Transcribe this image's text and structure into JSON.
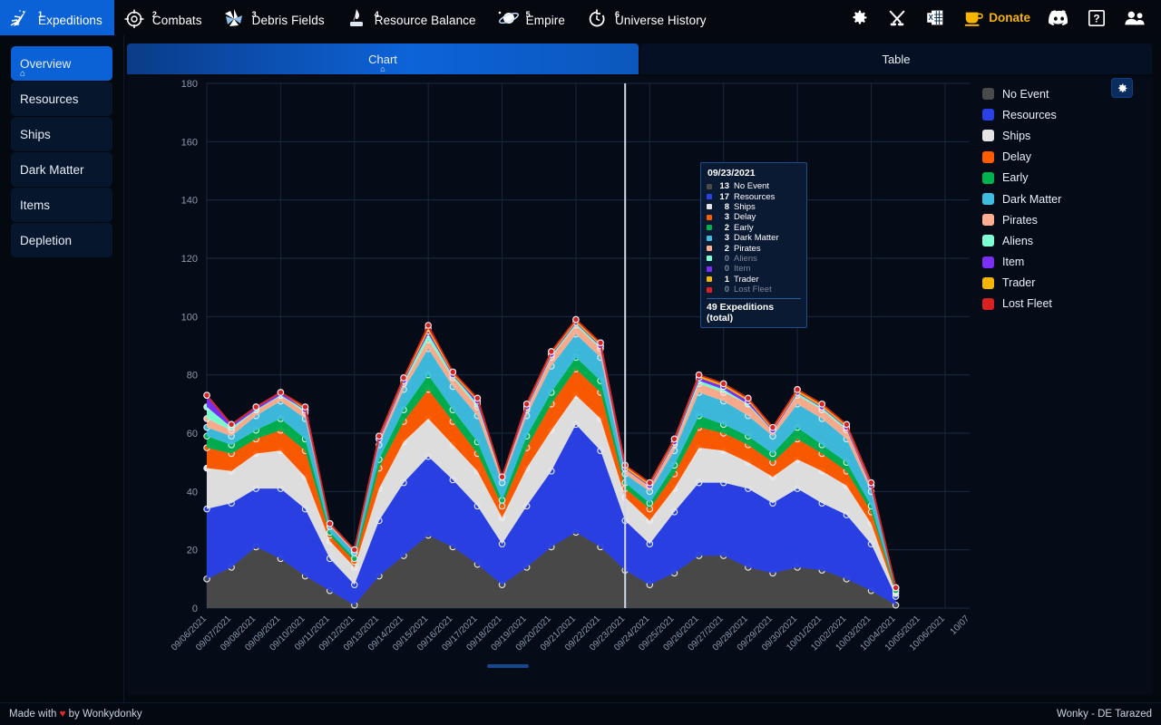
{
  "topnav": {
    "items": [
      {
        "num": "1",
        "label": "Expeditions",
        "icon": "comet-icon",
        "active": true,
        "home": true
      },
      {
        "num": "2",
        "label": "Combats",
        "icon": "crosshair-icon",
        "active": false
      },
      {
        "num": "3",
        "label": "Debris Fields",
        "icon": "debris-icon",
        "active": false
      },
      {
        "num": "4",
        "label": "Resource Balance",
        "icon": "resource-balance-icon",
        "active": false
      },
      {
        "num": "5",
        "label": "Empire",
        "icon": "planet-icon",
        "active": false
      },
      {
        "num": "6",
        "label": "Universe History",
        "icon": "clock-icon",
        "active": false
      }
    ],
    "tools": [
      {
        "name": "settings-icon",
        "glyph": "gear"
      },
      {
        "name": "tools-icon",
        "glyph": "tools"
      },
      {
        "name": "excel-export-icon",
        "glyph": "excel"
      }
    ],
    "donate": {
      "label": "Donate",
      "icon": "coffee-icon",
      "color": "#f7b500"
    },
    "right_icons": [
      {
        "name": "discord-icon"
      },
      {
        "name": "help-icon",
        "glyph": "?"
      },
      {
        "name": "users-icon"
      }
    ]
  },
  "sidebar": {
    "items": [
      {
        "label": "Overview",
        "active": true,
        "home": true
      },
      {
        "label": "Resources",
        "active": false
      },
      {
        "label": "Ships",
        "active": false
      },
      {
        "label": "Dark Matter",
        "active": false
      },
      {
        "label": "Items",
        "active": false
      },
      {
        "label": "Depletion",
        "active": false
      }
    ]
  },
  "tabs": [
    {
      "label": "Chart",
      "active": true,
      "home": true
    },
    {
      "label": "Table",
      "active": false
    }
  ],
  "tooltip": {
    "date": "09/23/2021",
    "rows": [
      {
        "value": "13",
        "label": "No Event",
        "color": "#4a4a4a",
        "zero": false
      },
      {
        "value": "17",
        "label": "Resources",
        "color": "#2a41e8",
        "zero": false
      },
      {
        "value": "8",
        "label": "Ships",
        "color": "#e4e4e4",
        "zero": false
      },
      {
        "value": "3",
        "label": "Delay",
        "color": "#ff5b00",
        "zero": false
      },
      {
        "value": "2",
        "label": "Early",
        "color": "#00b14f",
        "zero": false
      },
      {
        "value": "3",
        "label": "Dark Matter",
        "color": "#3fbde0",
        "zero": false
      },
      {
        "value": "2",
        "label": "Pirates",
        "color": "#ffae91",
        "zero": false
      },
      {
        "value": "0",
        "label": "Aliens",
        "color": "#7fffd4",
        "zero": true
      },
      {
        "value": "0",
        "label": "Item",
        "color": "#7b2ff7",
        "zero": true
      },
      {
        "value": "1",
        "label": "Trader",
        "color": "#f7b500",
        "zero": false
      },
      {
        "value": "0",
        "label": "Lost Fleet",
        "color": "#d92121",
        "zero": true
      }
    ],
    "total": "49 Expeditions (total)"
  },
  "legend": {
    "gear": "settings-icon",
    "items": [
      {
        "label": "No Event",
        "color": "#4a4a4a"
      },
      {
        "label": "Resources",
        "color": "#2a41e8"
      },
      {
        "label": "Ships",
        "color": "#e4e4e4"
      },
      {
        "label": "Delay",
        "color": "#ff5b00"
      },
      {
        "label": "Early",
        "color": "#00b14f"
      },
      {
        "label": "Dark Matter",
        "color": "#3fbde0"
      },
      {
        "label": "Pirates",
        "color": "#ffae91"
      },
      {
        "label": "Aliens",
        "color": "#7fffd4"
      },
      {
        "label": "Item",
        "color": "#7b2ff7"
      },
      {
        "label": "Trader",
        "color": "#f7b500"
      },
      {
        "label": "Lost Fleet",
        "color": "#d92121"
      }
    ]
  },
  "footer": {
    "left_pre": "Made with ",
    "heart": "♥",
    "left_post": " by Wonkydonky",
    "right": "Wonky - DE Tarazed"
  },
  "chart_data": {
    "type": "area",
    "stacked": true,
    "title": "",
    "xlabel": "",
    "ylabel": "",
    "ylim": [
      0,
      180
    ],
    "yticks": [
      0,
      20,
      40,
      60,
      80,
      100,
      120,
      140,
      160,
      180
    ],
    "grid": true,
    "legend_position": "right",
    "categories": [
      "09/06/2021",
      "09/07/2021",
      "09/08/2021",
      "09/09/2021",
      "09/10/2021",
      "09/11/2021",
      "09/12/2021",
      "09/13/2021",
      "09/14/2021",
      "09/15/2021",
      "09/16/2021",
      "09/17/2021",
      "09/18/2021",
      "09/19/2021",
      "09/20/2021",
      "09/21/2021",
      "09/22/2021",
      "09/23/2021",
      "09/24/2021",
      "09/25/2021",
      "09/26/2021",
      "09/27/2021",
      "09/28/2021",
      "09/29/2021",
      "09/30/2021",
      "10/01/2021",
      "10/02/2021",
      "10/03/2021",
      "10/04/2021",
      "10/05/2021",
      "10/06/2021",
      "10/07"
    ],
    "series": [
      {
        "name": "No Event",
        "color": "#4a4a4a",
        "values": [
          10,
          14,
          21,
          17,
          11,
          6,
          1,
          11,
          18,
          25,
          21,
          15,
          8,
          14,
          21,
          26,
          21,
          13,
          8,
          12,
          18,
          18,
          14,
          12,
          14,
          13,
          10,
          6,
          1,
          null,
          null,
          null
        ]
      },
      {
        "name": "Resources",
        "color": "#2a41e8",
        "values": [
          24,
          22,
          20,
          24,
          23,
          11,
          7,
          19,
          25,
          27,
          23,
          20,
          14,
          21,
          26,
          37,
          33,
          17,
          14,
          21,
          25,
          25,
          27,
          24,
          27,
          23,
          22,
          16,
          3,
          null,
          null,
          null
        ]
      },
      {
        "name": "Ships",
        "color": "#e4e4e4",
        "values": [
          14,
          11,
          12,
          13,
          11,
          6,
          6,
          11,
          14,
          13,
          12,
          12,
          9,
          13,
          14,
          10,
          11,
          8,
          8,
          8,
          12,
          11,
          9,
          9,
          10,
          11,
          10,
          7,
          1,
          null,
          null,
          null
        ]
      },
      {
        "name": "Delay",
        "color": "#ff5b00",
        "values": [
          7,
          6,
          5,
          7,
          9,
          2,
          2,
          7,
          7,
          10,
          8,
          6,
          4,
          7,
          9,
          9,
          9,
          3,
          4,
          5,
          7,
          6,
          6,
          5,
          7,
          6,
          5,
          4,
          1,
          null,
          null,
          null
        ]
      },
      {
        "name": "Early",
        "color": "#00b14f",
        "values": [
          4,
          3,
          3,
          4,
          4,
          1,
          1,
          3,
          4,
          5,
          4,
          4,
          2,
          4,
          4,
          4,
          4,
          2,
          2,
          3,
          4,
          3,
          3,
          3,
          4,
          3,
          3,
          2,
          0,
          null,
          null,
          null
        ]
      },
      {
        "name": "Dark Matter",
        "color": "#3fbde0",
        "values": [
          3,
          3,
          5,
          6,
          7,
          2,
          2,
          5,
          7,
          9,
          8,
          9,
          6,
          7,
          9,
          8,
          8,
          3,
          4,
          5,
          8,
          8,
          7,
          6,
          8,
          9,
          8,
          5,
          1,
          null,
          null,
          null
        ]
      },
      {
        "name": "Pirates",
        "color": "#ffae91",
        "values": [
          3,
          2,
          2,
          2,
          2,
          1,
          1,
          2,
          2,
          3,
          3,
          3,
          2,
          2,
          3,
          3,
          3,
          2,
          2,
          2,
          3,
          3,
          4,
          2,
          3,
          3,
          3,
          2,
          0,
          null,
          null,
          null
        ]
      },
      {
        "name": "Aliens",
        "color": "#7fffd4",
        "values": [
          4,
          1,
          0,
          0,
          1,
          0,
          0,
          0,
          1,
          2,
          1,
          1,
          0,
          1,
          1,
          1,
          1,
          0,
          0,
          1,
          1,
          1,
          0,
          0,
          1,
          1,
          1,
          0,
          0,
          null,
          null,
          null
        ]
      },
      {
        "name": "Item",
        "color": "#7b2ff7",
        "values": [
          4,
          1,
          1,
          1,
          0,
          0,
          0,
          0,
          0,
          1,
          0,
          1,
          0,
          0,
          0,
          0,
          0,
          0,
          0,
          0,
          1,
          1,
          1,
          0,
          0,
          0,
          0,
          0,
          0,
          null,
          null,
          null
        ]
      },
      {
        "name": "Trader",
        "color": "#f7b500",
        "values": [
          0,
          0,
          0,
          0,
          1,
          0,
          0,
          1,
          1,
          1,
          1,
          1,
          0,
          1,
          1,
          1,
          1,
          1,
          1,
          1,
          1,
          1,
          1,
          1,
          1,
          1,
          1,
          1,
          0,
          null,
          null,
          null
        ]
      },
      {
        "name": "Lost Fleet",
        "color": "#d92121",
        "values": [
          0,
          0,
          0,
          0,
          0,
          0,
          0,
          0,
          0,
          1,
          0,
          0,
          0,
          0,
          0,
          0,
          0,
          0,
          0,
          0,
          0,
          0,
          0,
          0,
          0,
          0,
          0,
          0,
          0,
          null,
          null,
          null
        ]
      }
    ]
  }
}
